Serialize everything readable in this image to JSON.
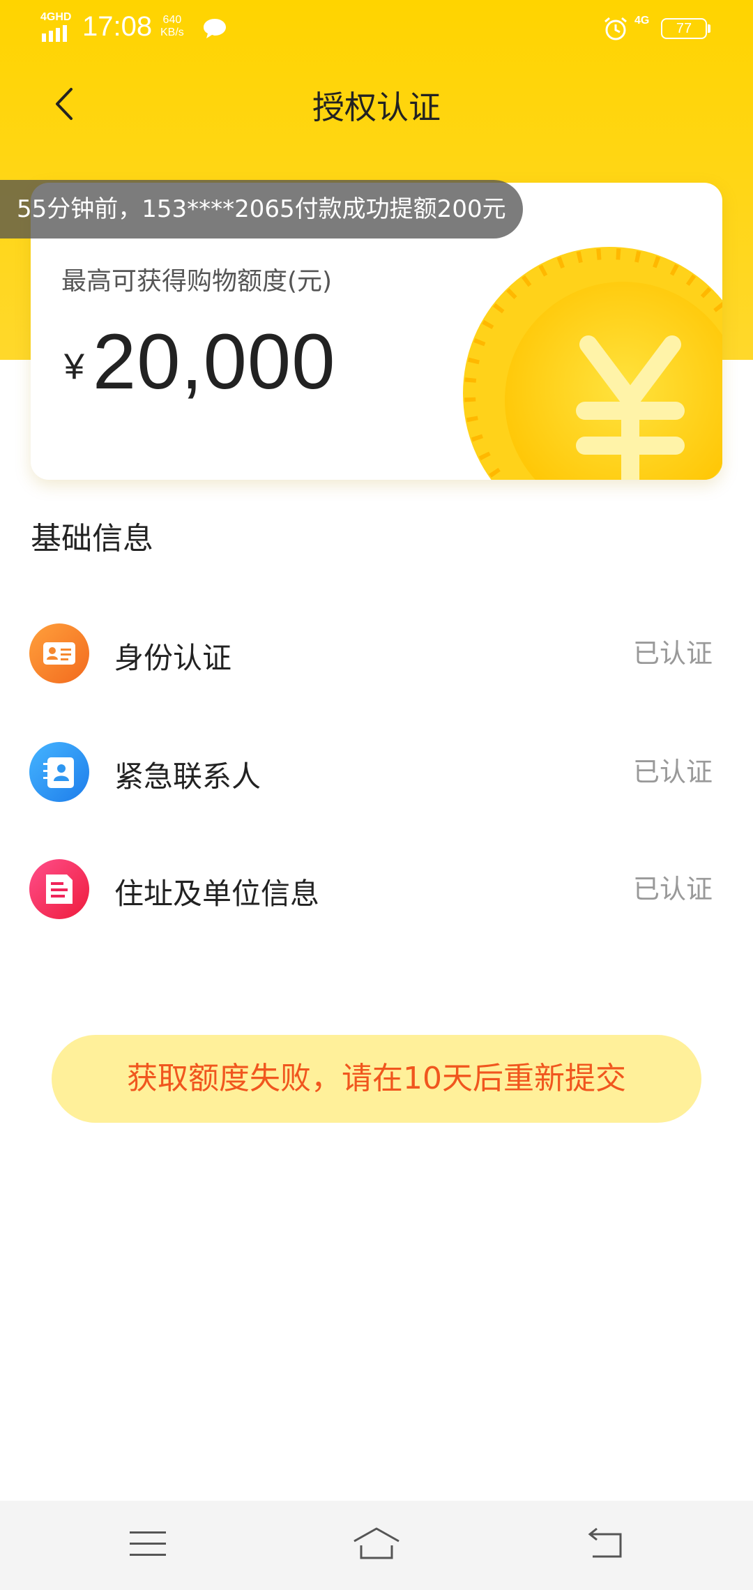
{
  "status_bar": {
    "network": "4GHD",
    "time": "17:08",
    "speed_value": "640",
    "speed_unit": "KB/s",
    "network_right": "4G",
    "battery": "77",
    "icons": [
      "signal-icon",
      "chat-icon",
      "alarm-icon",
      "battery-icon"
    ]
  },
  "header": {
    "title": "授权认证",
    "back_icon": "chevron-left-icon"
  },
  "toast": {
    "text": "55分钟前，153****2065付款成功提额200元"
  },
  "credit_card": {
    "label": "最高可获得购物额度(元)",
    "currency": "¥",
    "amount": "20,000",
    "decoration_icon": "yuan-coin-icon"
  },
  "basic_info": {
    "title": "基础信息",
    "items": [
      {
        "label": "身份认证",
        "status": "已认证",
        "icon": "id-card-icon",
        "color": "#F5882F"
      },
      {
        "label": "紧急联系人",
        "status": "已认证",
        "icon": "contact-book-icon",
        "color": "#2E96F0"
      },
      {
        "label": "住址及单位信息",
        "status": "已认证",
        "icon": "document-icon",
        "color": "#F0245A"
      }
    ]
  },
  "notice": {
    "text": "获取额度失败，请在10天后重新提交",
    "background": "#FFF09A",
    "text_color": "#F0561E"
  },
  "bottom_nav": {
    "icons": [
      "menu-icon",
      "home-icon",
      "back-icon"
    ]
  },
  "colors": {
    "brand_yellow": "#FFD400"
  }
}
